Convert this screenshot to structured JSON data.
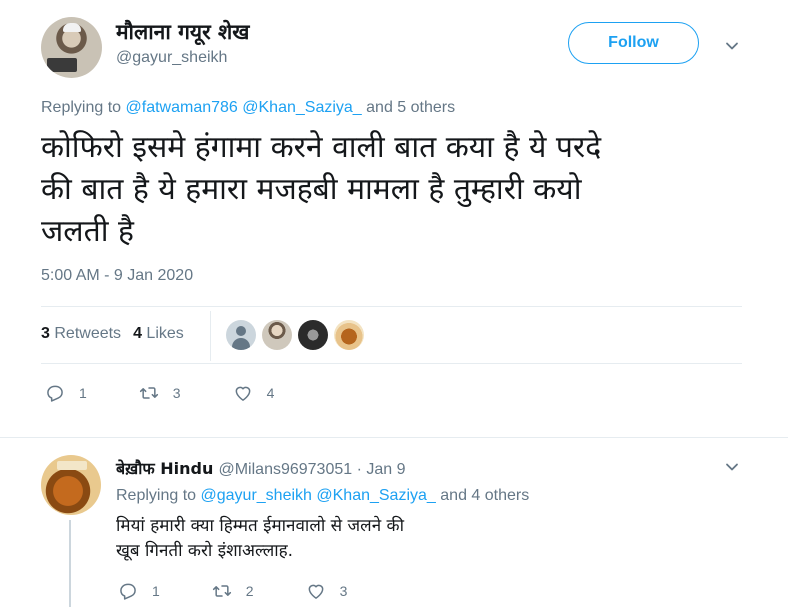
{
  "main_tweet": {
    "author_name": "मौलाना गयूर शेख",
    "author_handle": "@gayur_sheikh",
    "follow_label": "Follow",
    "replying_prefix": "Replying to",
    "replying_mentions": [
      "@fatwaman786",
      "@Khan_Saziya_"
    ],
    "replying_suffix": "and 5 others",
    "text_lines": [
      "कोफिरो इसमे हंगामा करने वाली बात कया है ये परदे",
      "की बात है ये हमारा मजहबी मामला है तुम्हारी कयो",
      "जलती है"
    ],
    "timestamp": "5:00 AM - 9 Jan 2020",
    "retweets_count": "3",
    "retweets_label": "Retweets",
    "likes_count": "4",
    "likes_label": "Likes",
    "actions": {
      "reply_count": "1",
      "retweet_count": "3",
      "like_count": "4"
    }
  },
  "reply_tweet": {
    "author_name": "बेख़ौफ Hindu",
    "author_handle_date": "@Milans96973051 · Jan 9",
    "replying_prefix": "Replying to",
    "replying_mentions": [
      "@gayur_sheikh",
      "@Khan_Saziya_"
    ],
    "replying_suffix": "and 4 others",
    "text_lines": [
      "मियां हमारी क्या हिम्मत ईमानवालो से जलने की",
      "खूब गिनती करो इंशाअल्लाह."
    ],
    "actions": {
      "reply_count": "1",
      "retweet_count": "2",
      "like_count": "3"
    }
  },
  "colors": {
    "accent": "#1da1f2",
    "secondary_text": "#657786",
    "primary_text": "#14171a",
    "divider": "#e6ecf0"
  },
  "icons": [
    "reply-icon",
    "retweet-icon",
    "like-icon",
    "chevron-down-icon"
  ]
}
